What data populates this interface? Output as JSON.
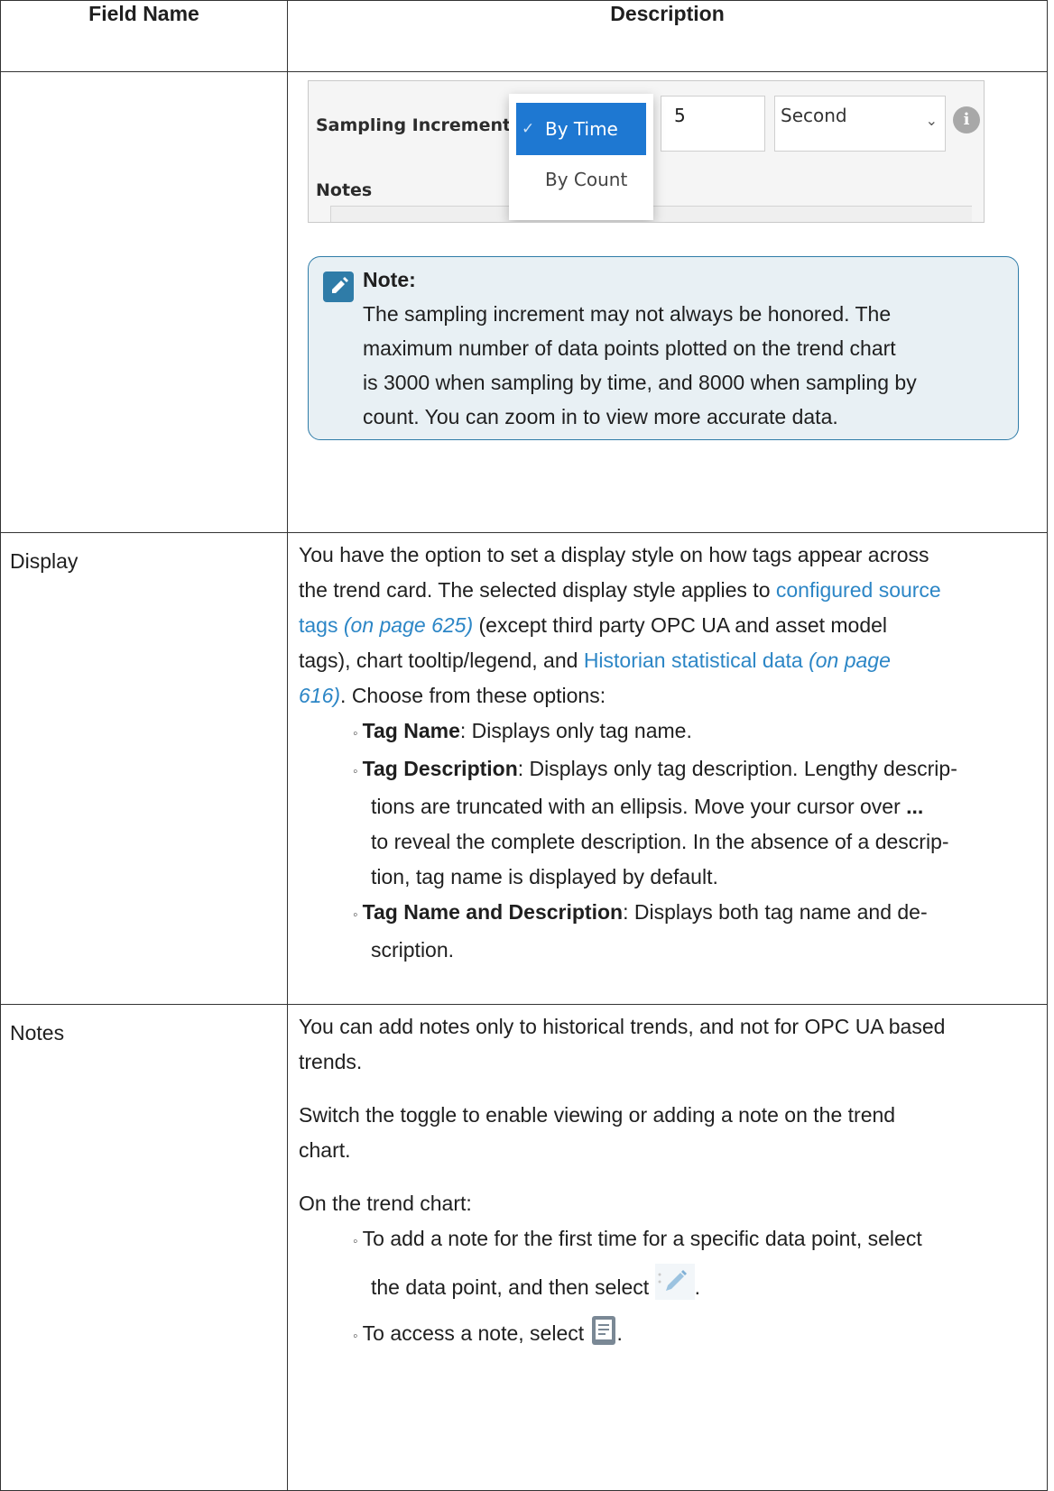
{
  "table": {
    "headers": {
      "field_name": "Field Name",
      "description": "Description"
    }
  },
  "sampling_screenshot": {
    "sampling_increment_label": "Sampling Increment",
    "notes_label": "Notes",
    "options": [
      "By Time",
      "By Count"
    ],
    "selected_option": "By Time",
    "increment_value": "5",
    "unit_value": "Second"
  },
  "note": {
    "title": "Note:",
    "lines": [
      "The sampling increment may not always be honored. The",
      "maximum number of data points plotted on the trend chart",
      "is 3000 when sampling by time, and 8000 when sampling by",
      "count. You can zoom in to view more accurate data."
    ]
  },
  "display_row": {
    "field": "Display",
    "intro_1": "You have the option to set a display style on how tags appear across",
    "intro_2": "the trend card. The selected display style applies to ",
    "link1_text": "configured source",
    "link1_text2": "tags",
    "link1_ref": "(on page 625)",
    "intro_3": " (except third party OPC UA and asset model",
    "intro_4": "tags), chart tooltip/legend, and ",
    "link2_text": "Historian statistical data",
    "link2_ref": "(on page",
    "link2_ref2": "616)",
    "intro_5": ". Choose from these options:",
    "options": [
      {
        "term": "Tag Name",
        "text": ": Displays only tag name."
      },
      {
        "term": "Tag Description",
        "text": ": Displays only tag description. Lengthy descrip-"
      },
      {
        "term": "Tag Name and Description",
        "text": ": Displays both tag name and de-"
      }
    ],
    "desc_cont": [
      "tions are truncated with an ellipsis. Move your cursor over ",
      "...",
      "to reveal the complete description. In the absence of a descrip-",
      "tion, tag name is displayed by default."
    ],
    "both_cont": "scription."
  },
  "notes_row": {
    "field": "Notes",
    "p1_line1": "You can add notes only to historical trends, and not for OPC UA based",
    "p1_line2": "trends.",
    "p2_line1": "Switch the toggle to enable viewing or adding a note on the trend",
    "p2_line2": "chart.",
    "p3": "On the trend chart:",
    "bullet1_line1": "To add a note for the first time for a specific data point, select",
    "bullet1_line2": "the data point, and then select ",
    "bullet2": "To access a note, select ",
    "period": "."
  },
  "icons": [
    "note-edit-icon",
    "checkmark-icon",
    "chevron-down-icon",
    "info-icon",
    "pencil-icon",
    "note-icon"
  ]
}
